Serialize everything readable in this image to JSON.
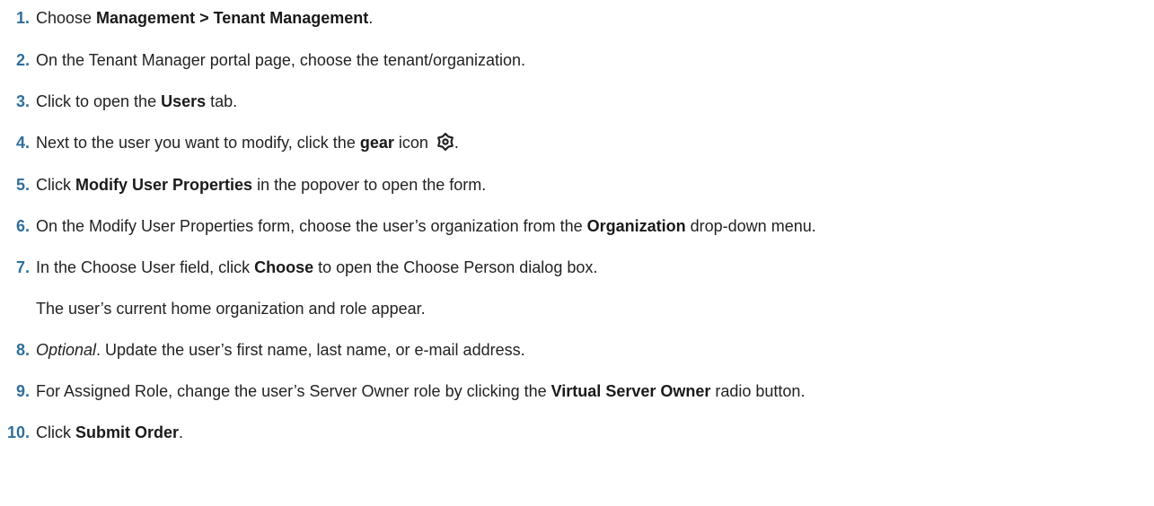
{
  "steps": [
    {
      "number": "1.",
      "parts": [
        {
          "t": "Choose "
        },
        {
          "t": "Management > Tenant Management",
          "b": true
        },
        {
          "t": "."
        }
      ]
    },
    {
      "number": "2.",
      "parts": [
        {
          "t": "On the Tenant Manager portal page, choose the tenant/organization."
        }
      ]
    },
    {
      "number": "3.",
      "parts": [
        {
          "t": "Click to open the "
        },
        {
          "t": "Users",
          "b": true
        },
        {
          "t": " tab."
        }
      ]
    },
    {
      "number": "4.",
      "parts": [
        {
          "t": "Next to the user you want to modify, click the "
        },
        {
          "t": "gear",
          "b": true
        },
        {
          "t": " icon "
        },
        {
          "icon": "gear-icon"
        },
        {
          "t": "."
        }
      ]
    },
    {
      "number": "5.",
      "parts": [
        {
          "t": "Click "
        },
        {
          "t": "Modify User Properties",
          "b": true
        },
        {
          "t": " in the popover to open the form."
        }
      ]
    },
    {
      "number": "6.",
      "parts": [
        {
          "t": "On the Modify User Properties form, choose the user’s organization from the "
        },
        {
          "t": "Organization",
          "b": true
        },
        {
          "t": " drop-down menu."
        }
      ]
    },
    {
      "number": "7.",
      "parts": [
        {
          "t": "In the Choose User field, click "
        },
        {
          "t": "Choose",
          "b": true
        },
        {
          "t": " to open the Choose Person dialog box."
        }
      ],
      "note": "The user’s current home organization and role appear."
    },
    {
      "number": "8.",
      "parts": [
        {
          "t": "Optional",
          "i": true
        },
        {
          "t": ". Update the user’s first name, last name, or e-mail address."
        }
      ]
    },
    {
      "number": "9.",
      "parts": [
        {
          "t": "For Assigned Role, change the user’s Server Owner role by clicking the "
        },
        {
          "t": "Virtual Server Owner",
          "b": true
        },
        {
          "t": " radio button."
        }
      ]
    },
    {
      "number": "10.",
      "parts": [
        {
          "t": "Click "
        },
        {
          "t": "Submit Order",
          "b": true
        },
        {
          "t": "."
        }
      ]
    }
  ]
}
